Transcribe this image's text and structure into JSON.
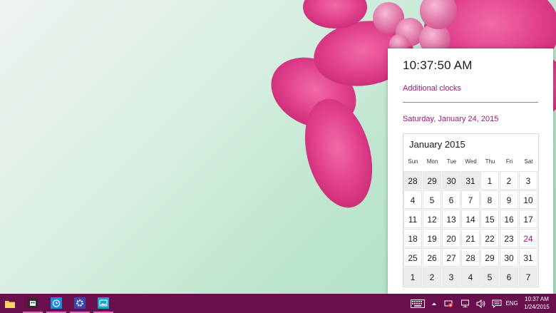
{
  "flyout": {
    "time": "10:37:50 AM",
    "additional_clocks": "Additional clocks",
    "date_long": "Saturday, January 24, 2015"
  },
  "calendar": {
    "month_label": "January 2015",
    "weekdays": [
      "Sun",
      "Mon",
      "Tue",
      "Wed",
      "Thu",
      "Fri",
      "Sat"
    ],
    "weeks": [
      [
        "28",
        "29",
        "30",
        "31",
        "1",
        "2",
        "3"
      ],
      [
        "4",
        "5",
        "6",
        "7",
        "8",
        "9",
        "10"
      ],
      [
        "11",
        "12",
        "13",
        "14",
        "15",
        "16",
        "17"
      ],
      [
        "18",
        "19",
        "20",
        "21",
        "22",
        "23",
        "24"
      ],
      [
        "25",
        "26",
        "27",
        "28",
        "29",
        "30",
        "31"
      ],
      [
        "1",
        "2",
        "3",
        "4",
        "5",
        "6",
        "7"
      ]
    ],
    "today": "24"
  },
  "taskbar": {
    "language": "ENG",
    "time": "10:37 AM",
    "date": "1/24/2015",
    "color": "#6a0f4d"
  },
  "colors": {
    "accent": "#a0157a"
  }
}
